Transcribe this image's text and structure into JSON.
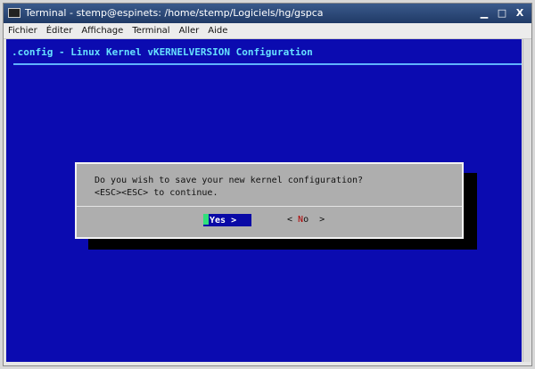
{
  "window": {
    "title": "Terminal - stemp@espinets: /home/stemp/Logiciels/hg/gspca",
    "controls": [
      "▁",
      "□",
      "X"
    ]
  },
  "menubar": [
    "Fichier",
    "Éditer",
    "Affichage",
    "Terminal",
    "Aller",
    "Aide"
  ],
  "terminal": {
    "back_title": ".config - Linux Kernel vKERNELVERSION Configuration",
    "dialog": {
      "line1": "Do you wish to save your new kernel configuration?",
      "line2": "<ESC><ESC> to continue.",
      "yes_label": "Yes >",
      "no_left": "< ",
      "no_hot": "N",
      "no_rest": "o",
      "no_right": "  >"
    }
  },
  "colors": {
    "terminal_bg": "#0b0bb0",
    "dialog_bg": "#aeaeae",
    "title_text": "#66e0ff",
    "selected_button_bg": "#0a0aa6",
    "hotkey": "#b00000"
  }
}
